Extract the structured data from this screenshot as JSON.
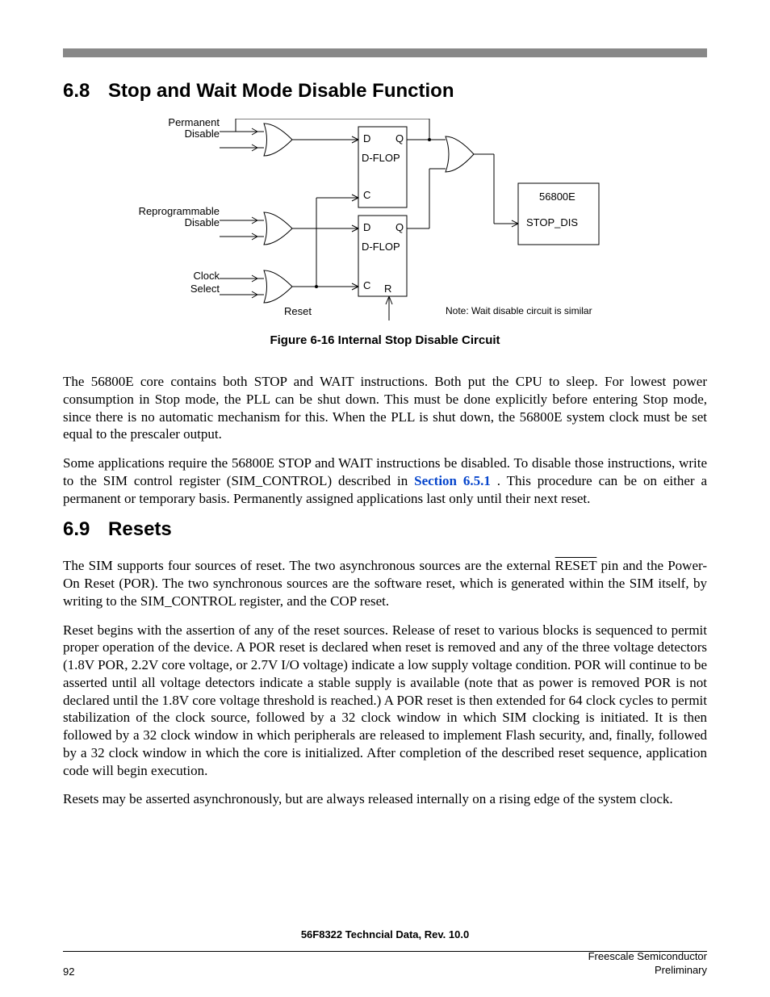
{
  "sections": {
    "s68": {
      "num": "6.8",
      "title": "Stop and Wait Mode Disable Function"
    },
    "s69": {
      "num": "6.9",
      "title": "Resets"
    }
  },
  "figure": {
    "caption": "Figure 6-16 Internal Stop Disable Circuit",
    "labels": {
      "permanent": "Permanent",
      "disable": "Disable",
      "reprogrammable": "Reprogrammable",
      "clock": "Clock",
      "select": "Select",
      "reset": "Reset",
      "d": "D",
      "q": "Q",
      "c": "C",
      "r": "R",
      "dflop": "D-FLOP",
      "core": "56800E",
      "stopdis": "STOP_DIS",
      "note": "Note: Wait disable circuit is similar"
    }
  },
  "paragraphs": {
    "p1": "The 56800E core contains both STOP and WAIT instructions. Both put the CPU to sleep. For lowest power consumption in Stop mode, the PLL can be shut down. This must be done explicitly before entering Stop mode, since there is no automatic mechanism for this. When the PLL is shut down, the 56800E system clock must be set equal to the prescaler output.",
    "p2a": "Some applications require the 56800E STOP and WAIT instructions be disabled. To disable those instructions, write to the SIM control register (SIM_CONTROL) described in ",
    "p2link": "Section 6.5.1",
    "p2b": " . This procedure can be on either a permanent or temporary basis. Permanently assigned applications last only until their next reset.",
    "p3a": "The SIM supports four sources of reset. The two asynchronous sources are the external ",
    "p3reset": "RESET",
    "p3b": " pin and the Power-On Reset (POR). The two synchronous sources are the software reset, which is generated within the SIM itself, by writing to the SIM_CONTROL register, and the COP reset.",
    "p4": "Reset begins with the assertion of any of the reset sources. Release of reset to various blocks is sequenced to permit proper operation of the device. A POR reset is declared when reset is removed and any of the three voltage detectors (1.8V POR, 2.2V core voltage, or 2.7V I/O voltage) indicate a low supply voltage condition. POR will continue to be asserted until all voltage detectors indicate a stable supply is available (note that as power is removed POR is not declared until the 1.8V core voltage threshold is reached.) A POR reset is then extended for 64 clock cycles to permit stabilization of the clock source, followed by a 32 clock window in which SIM clocking is initiated. It is then followed by a 32 clock window in which peripherals are released to implement Flash security, and, finally, followed by a 32 clock window in which the core is initialized. After completion of the described reset sequence, application code will begin execution.",
    "p5": "Resets may be asserted asynchronously, but are always released internally on a rising edge of the system clock."
  },
  "footer": {
    "doc": "56F8322 Techncial Data, Rev. 10.0",
    "page": "92",
    "company": "Freescale Semiconductor",
    "status": "Preliminary"
  }
}
